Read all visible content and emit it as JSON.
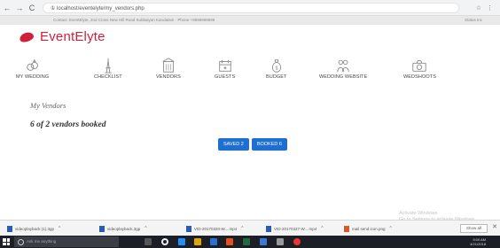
{
  "browser": {
    "back": "←",
    "forward": "→",
    "reload": "C",
    "url": "① localhost/eventelyte/my_vendors.php",
    "icons": [
      "☆",
      "⋮"
    ]
  },
  "topbar": {
    "info": "Contact: EventElyte, 2nd Cross New Hill Road Subbaiyan Kandalam · Phone +9999999999",
    "user": "Status Inc"
  },
  "brand": {
    "name": "EventElyte",
    "color": "#d21f3c"
  },
  "menu": [
    {
      "label": "MY WEDDING",
      "icon": "rings-icon"
    },
    {
      "label": "CHECKLIST",
      "icon": "tower-icon"
    },
    {
      "label": "VENDORS",
      "icon": "building-icon"
    },
    {
      "label": "GUESTS",
      "icon": "calendar-icon"
    },
    {
      "label": "BUDGET",
      "icon": "money-bag-icon"
    },
    {
      "label": "WEDDING WEBSITE",
      "icon": "couple-icon"
    },
    {
      "label": "WEDSHOOTS",
      "icon": "camera-icon"
    }
  ],
  "content": {
    "title": "My Vendors",
    "summary": "6 of 2 vendors booked",
    "tabs": [
      "SAVED 2",
      "BOOKED 6"
    ],
    "accent": "#1f6fd1"
  },
  "watermark": {
    "line1": "Activate Windows",
    "line2": "Go to Settings to activate Windows."
  },
  "downloads": {
    "items": [
      {
        "name": "videoplayback (1).3gp"
      },
      {
        "name": "videoplayback.3gp"
      },
      {
        "name": "VID-20170320-W....mp4"
      },
      {
        "name": "VID-20170327-W....mp4"
      },
      {
        "name": "mail send icon.png"
      }
    ],
    "show_all": "Show all",
    "close": "✕"
  },
  "taskbar": {
    "search_placeholder": "Ask me anything",
    "clock_time": "9:00 AM",
    "clock_date": "4/21/2018"
  }
}
